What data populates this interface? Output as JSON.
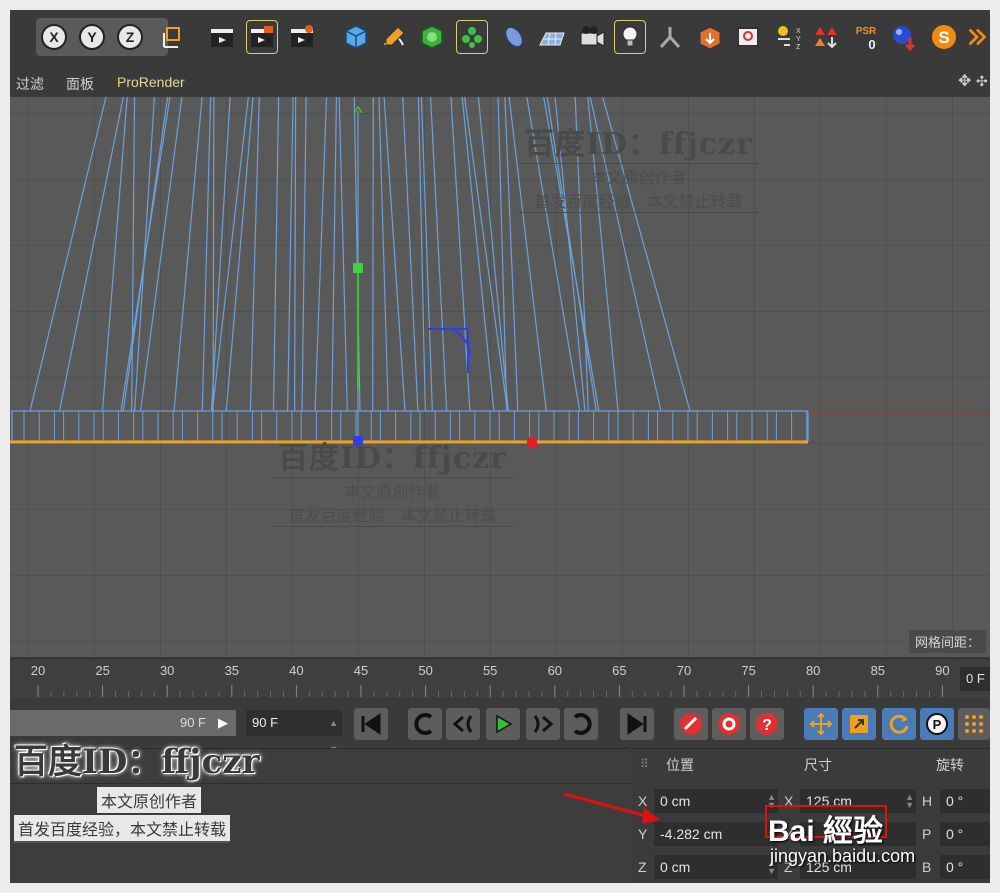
{
  "menu": {
    "filter": "过滤",
    "panel": "面板",
    "prorender": "ProRender"
  },
  "toolbar": {
    "x_label": "X",
    "y_label": "Y",
    "z_label": "Z",
    "psr_label": "PSR",
    "psr_value": "0",
    "s_label": "S"
  },
  "viewport": {
    "grid_label": "网格间距：",
    "watermark": {
      "title": "百度ID：ffjczr",
      "line1": "本文原创作者",
      "line2": "首发百度经验　本文禁止转载"
    }
  },
  "timeline": {
    "ticks": [
      "20",
      "25",
      "30",
      "35",
      "40",
      "45",
      "50",
      "55",
      "60",
      "65",
      "70",
      "75",
      "80",
      "85",
      "90"
    ],
    "current_frame": "0 F"
  },
  "transport": {
    "end_frame_a": "90 F",
    "end_frame_b": "90 F"
  },
  "attributes": {
    "position_label": "位置",
    "size_label": "尺寸",
    "rotation_label": "旋转",
    "position": {
      "x_axis": "X",
      "y_axis": "Y",
      "z_axis": "Z",
      "x": "0 cm",
      "y": "-4.282 cm",
      "z": "0 cm"
    },
    "size": {
      "x_axis": "X",
      "y_axis": "Y",
      "z_axis": "Z",
      "x": "125 cm",
      "z": "125 cm"
    },
    "rotation": {
      "h_axis": "H",
      "p_axis": "P",
      "b_axis": "B",
      "h": "0 °",
      "p": "0 °",
      "b": "0 °"
    }
  },
  "bottom_watermark": {
    "title": "百度ID：ffjczr",
    "line1": "本文原创作者",
    "line2": "首发百度经验，本文禁止转载"
  },
  "baidu": {
    "logo": "Bai 經验",
    "url": "jingyan.baidu.com"
  },
  "colors": {
    "wire": "#6fa0d8",
    "selection": "#f0a020",
    "y_axis": "#40c040",
    "x_axis": "#e03030",
    "z_axis": "#3040e0",
    "highlight": "#d8d070"
  }
}
